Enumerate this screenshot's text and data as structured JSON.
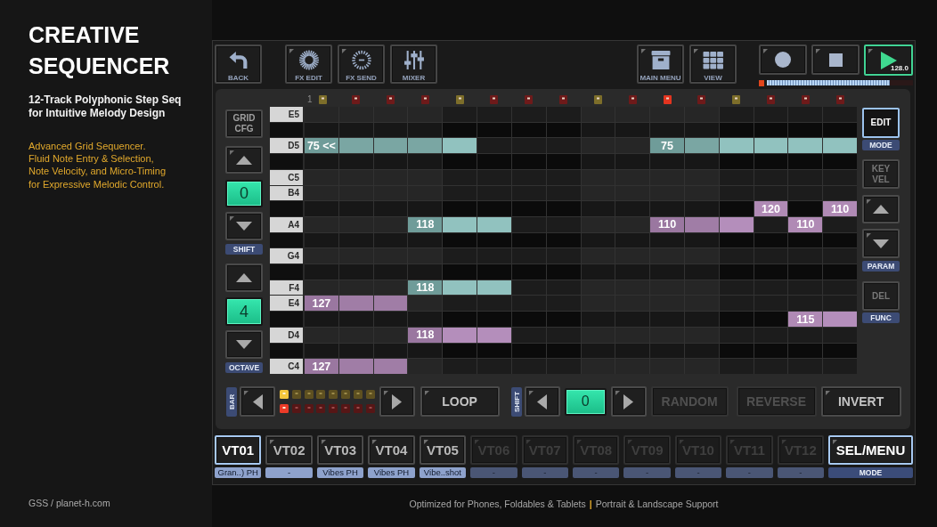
{
  "promo": {
    "title": "CREATIVE SEQUENCER",
    "subtitle": "12-Track Polyphonic Step Seq for Intuitive Melody Design",
    "features": [
      "Advanced Grid Sequencer.",
      "Fluid Note Entry & Selection, Note Velocity, and Micro-Timing for Expressive Melodic Control."
    ],
    "credit": "GSS / planet-h.com"
  },
  "toolbar": {
    "nav": [
      {
        "kind": "back",
        "label": "BACK"
      }
    ],
    "effects": [
      {
        "kind": "fx_edit",
        "label": "FX EDIT",
        "corner_mark": true
      },
      {
        "kind": "fx_send",
        "label": "FX SEND",
        "corner_mark": true
      },
      {
        "kind": "mixer",
        "label": "MIXER"
      }
    ],
    "menus": [
      {
        "kind": "main_menu",
        "label": "MAIN MENU",
        "corner_mark": true
      },
      {
        "kind": "view",
        "label": "VIEW",
        "corner_mark": true
      }
    ],
    "transport": [
      {
        "kind": "record",
        "on": false,
        "corner_mark": true
      },
      {
        "kind": "stop",
        "on": false,
        "corner_mark": true
      },
      {
        "kind": "play",
        "on": true,
        "tempo": "128.0",
        "corner_mark": true
      }
    ],
    "position": {
      "level": 0.84
    }
  },
  "sequencer": {
    "step_header": {
      "label": "1",
      "markers": [
        {
          "color": "#7d6e2a"
        },
        {
          "color": "#6e1a1a"
        },
        {
          "color": "#6e1a1a"
        },
        {
          "color": "#6e1a1a"
        },
        {
          "color": "#7d6e2a"
        },
        {
          "color": "#6e1a1a"
        },
        {
          "color": "#6e1a1a"
        },
        {
          "color": "#6e1a1a"
        },
        {
          "color": "#7d6e2a"
        },
        {
          "color": "#6e1a1a"
        },
        {
          "color": "#e3341f"
        },
        {
          "color": "#6e1a1a"
        },
        {
          "color": "#7d6e2a"
        },
        {
          "color": "#6e1a1a"
        },
        {
          "color": "#6e1a1a"
        },
        {
          "color": "#6e1a1a"
        }
      ]
    },
    "left_controls": {
      "grid_cfg": {
        "label": "GRID CFG"
      },
      "shift": {
        "caption": "SHIFT",
        "value": "0",
        "up": {
          "corner_mark": true
        },
        "down": {
          "corner_mark": true
        }
      },
      "octave": {
        "caption": "OCTAVE",
        "value": "4"
      }
    },
    "rows": [
      {
        "kind": "white",
        "note": "E5"
      },
      {
        "kind": "black"
      },
      {
        "kind": "white",
        "note": "D5",
        "cells": [
          {
            "selected": true,
            "label": "75 <<"
          },
          {
            "selected": true
          },
          {
            "selected": true
          },
          {
            "selected": true
          },
          {
            "selected": true
          },
          null,
          null,
          null,
          null,
          null,
          {
            "selected": true,
            "label": "75"
          },
          {
            "selected": true
          },
          {
            "selected": true
          },
          {
            "selected": true
          },
          {
            "selected": true
          },
          {
            "selected": true
          }
        ]
      },
      {
        "kind": "black"
      },
      {
        "kind": "white",
        "note": "C5"
      },
      {
        "kind": "white",
        "note": "B4"
      },
      {
        "kind": "black",
        "cells": [
          null,
          null,
          null,
          null,
          null,
          null,
          null,
          null,
          null,
          null,
          null,
          null,
          null,
          {
            "selected": false,
            "label": "120"
          },
          null,
          {
            "selected": false,
            "label": "110"
          }
        ]
      },
      {
        "kind": "white",
        "note": "A4",
        "cells": [
          null,
          null,
          null,
          {
            "selected": true,
            "label": "118"
          },
          {
            "selected": true
          },
          {
            "selected": true
          },
          null,
          null,
          null,
          null,
          {
            "selected": false,
            "label": "110"
          },
          {
            "selected": false
          },
          {
            "selected": false
          },
          null,
          {
            "selected": false,
            "label": "110"
          },
          null
        ]
      },
      {
        "kind": "black"
      },
      {
        "kind": "white",
        "note": "G4"
      },
      {
        "kind": "black"
      },
      {
        "kind": "white",
        "note": "F4",
        "cells": [
          null,
          null,
          null,
          {
            "selected": true,
            "label": "118"
          },
          {
            "selected": true
          },
          {
            "selected": true
          },
          null,
          null,
          null,
          null,
          null,
          null,
          null,
          null,
          null,
          null
        ]
      },
      {
        "kind": "white",
        "note": "E4",
        "cells": [
          {
            "selected": false,
            "label": "127"
          },
          {
            "selected": false
          },
          {
            "selected": false
          },
          null,
          null,
          null,
          null,
          null,
          null,
          null,
          null,
          null,
          null,
          null,
          null,
          null
        ]
      },
      {
        "kind": "black",
        "cells": [
          null,
          null,
          null,
          null,
          null,
          null,
          null,
          null,
          null,
          null,
          null,
          null,
          null,
          null,
          {
            "selected": false,
            "label": "115"
          },
          {
            "selected": false
          }
        ]
      },
      {
        "kind": "white",
        "note": "D4",
        "cells": [
          null,
          null,
          null,
          {
            "selected": false,
            "label": "118"
          },
          {
            "selected": false
          },
          {
            "selected": false
          },
          null,
          null,
          null,
          null,
          null,
          null,
          null,
          null,
          null,
          null
        ]
      },
      {
        "kind": "black"
      },
      {
        "kind": "white",
        "note": "C4",
        "cells": [
          {
            "selected": false,
            "label": "127"
          },
          {
            "selected": false
          },
          {
            "selected": false
          },
          null,
          null,
          null,
          null,
          null,
          null,
          null,
          null,
          null,
          null,
          null,
          null,
          null
        ]
      }
    ],
    "right_controls": {
      "edit": {
        "label": "EDIT",
        "selected": true,
        "caption": "MODE"
      },
      "key_vel": {
        "label": "KEY VEL",
        "disabled": true
      },
      "param": {
        "caption": "PARAM",
        "up": {
          "corner_mark": true
        },
        "down": {
          "corner_mark": true
        }
      },
      "del": {
        "label": "DEL",
        "disabled": true,
        "caption": "FUNC"
      }
    },
    "bottom": {
      "bar": {
        "caption": "BAR",
        "prev": {
          "corner_mark": true
        },
        "next": {
          "corner_mark": true
        },
        "leds_upper": [
          {
            "on": true
          },
          {
            "on": false
          },
          {
            "on": false
          },
          {
            "on": false
          },
          {
            "on": false
          },
          {
            "on": false
          },
          {
            "on": false
          },
          {
            "on": false
          }
        ],
        "leds_lower": [
          {
            "on": true
          },
          {
            "on": false
          },
          {
            "on": false
          },
          {
            "on": false
          },
          {
            "on": false
          },
          {
            "on": false
          },
          {
            "on": false
          },
          {
            "on": false
          }
        ]
      },
      "loop": {
        "label": "LOOP",
        "corner_mark": true
      },
      "shift": {
        "caption": "SHIFT",
        "value": "0",
        "prev": {
          "corner_mark": true
        },
        "next": {
          "corner_mark": true
        }
      },
      "actions": [
        {
          "label": "RANDOM",
          "disabled": true
        },
        {
          "label": "REVERSE",
          "disabled": true
        },
        {
          "label": "INVERT",
          "disabled": false,
          "corner_mark": true
        }
      ]
    }
  },
  "tracks": [
    {
      "label": "VT01",
      "sublabel": "Gran..) PH",
      "selected": true,
      "disabled": false
    },
    {
      "label": "VT02",
      "sublabel": "-",
      "selected": false,
      "disabled": false,
      "corner_mark": true
    },
    {
      "label": "VT03",
      "sublabel": "Vibes PH",
      "selected": false,
      "disabled": false,
      "corner_mark": true
    },
    {
      "label": "VT04",
      "sublabel": "Vibes PH",
      "selected": false,
      "disabled": false,
      "corner_mark": true
    },
    {
      "label": "VT05",
      "sublabel": "Vibe..shot",
      "selected": false,
      "disabled": false,
      "corner_mark": true
    },
    {
      "label": "VT06",
      "sublabel": "-",
      "selected": false,
      "disabled": true,
      "corner_mark": true
    },
    {
      "label": "VT07",
      "sublabel": "-",
      "selected": false,
      "disabled": true,
      "corner_mark": true
    },
    {
      "label": "VT08",
      "sublabel": "-",
      "selected": false,
      "disabled": true,
      "corner_mark": true
    },
    {
      "label": "VT09",
      "sublabel": "-",
      "selected": false,
      "disabled": true,
      "corner_mark": true
    },
    {
      "label": "VT10",
      "sublabel": "-",
      "selected": false,
      "disabled": true,
      "corner_mark": true
    },
    {
      "label": "VT11",
      "sublabel": "-",
      "selected": false,
      "disabled": true,
      "corner_mark": true
    },
    {
      "label": "VT12",
      "sublabel": "-",
      "selected": false,
      "disabled": true,
      "corner_mark": true
    }
  ],
  "track_menu": {
    "label": "SEL/MENU",
    "caption": "MODE",
    "selected": true,
    "corner_mark": true
  },
  "footer": {
    "note": "Optimized for Phones, Foldables & Tablets",
    "separator": "|",
    "note_2": "Portrait & Landscape Support"
  }
}
